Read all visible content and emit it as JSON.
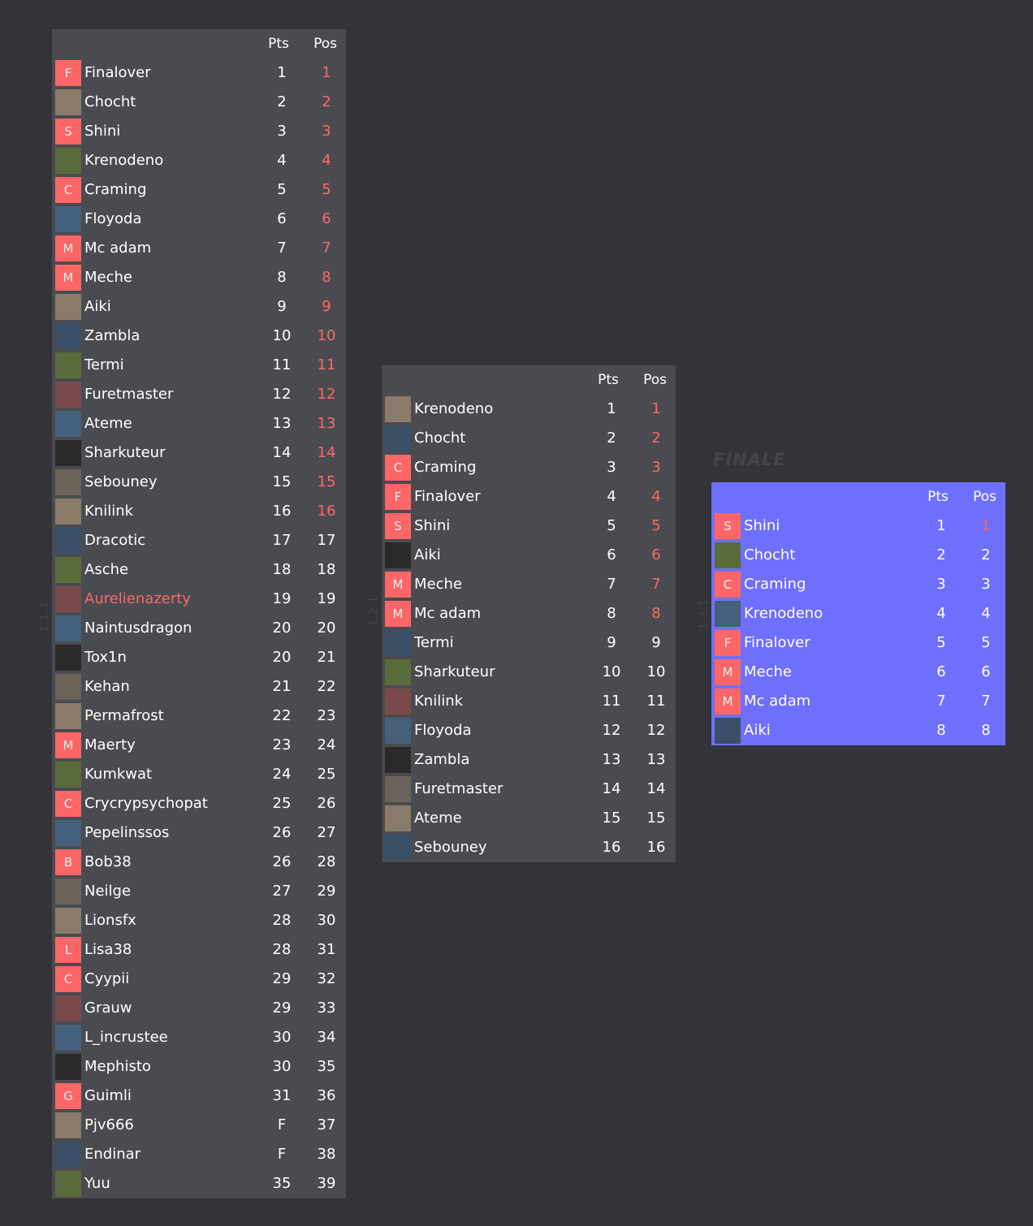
{
  "colors": {
    "page_bg": "#333439",
    "table_bg": "#4a4b50",
    "final_bg": "#6f6ffd",
    "accent_red": "#fd6767"
  },
  "headers": {
    "pts": "Pts",
    "pos": "Pos"
  },
  "groups": [
    {
      "label": "1.1.1",
      "rows": [
        {
          "name": "Finalover",
          "avatar": "F",
          "pts": "1",
          "pos": "1",
          "pos_red": true
        },
        {
          "name": "Chocht",
          "avatar": "img",
          "pts": "2",
          "pos": "2",
          "pos_red": true
        },
        {
          "name": "Shini",
          "avatar": "S",
          "pts": "3",
          "pos": "3",
          "pos_red": true
        },
        {
          "name": "Krenodeno",
          "avatar": "img",
          "pts": "4",
          "pos": "4",
          "pos_red": true
        },
        {
          "name": "Craming",
          "avatar": "C",
          "pts": "5",
          "pos": "5",
          "pos_red": true
        },
        {
          "name": "Floyoda",
          "avatar": "img",
          "pts": "6",
          "pos": "6",
          "pos_red": true
        },
        {
          "name": "Mc adam",
          "avatar": "M",
          "pts": "7",
          "pos": "7",
          "pos_red": true
        },
        {
          "name": "Meche",
          "avatar": "M",
          "pts": "8",
          "pos": "8",
          "pos_red": true
        },
        {
          "name": "Aiki",
          "avatar": "img",
          "pts": "9",
          "pos": "9",
          "pos_red": true
        },
        {
          "name": "Zambla",
          "avatar": "img",
          "pts": "10",
          "pos": "10",
          "pos_red": true
        },
        {
          "name": "Termi",
          "avatar": "img",
          "pts": "11",
          "pos": "11",
          "pos_red": true
        },
        {
          "name": "Furetmaster",
          "avatar": "img",
          "pts": "12",
          "pos": "12",
          "pos_red": true
        },
        {
          "name": "Ateme",
          "avatar": "img",
          "pts": "13",
          "pos": "13",
          "pos_red": true
        },
        {
          "name": "Sharkuteur",
          "avatar": "img",
          "pts": "14",
          "pos": "14",
          "pos_red": true
        },
        {
          "name": "Sebouney",
          "avatar": "img",
          "pts": "15",
          "pos": "15",
          "pos_red": true
        },
        {
          "name": "Knilink",
          "avatar": "img",
          "pts": "16",
          "pos": "16",
          "pos_red": true
        },
        {
          "name": "Dracotic",
          "avatar": "img",
          "pts": "17",
          "pos": "17"
        },
        {
          "name": "Asche",
          "avatar": "img",
          "pts": "18",
          "pos": "18"
        },
        {
          "name": "Aurelienazerty",
          "avatar": "img",
          "pts": "19",
          "pos": "19",
          "highlight": true
        },
        {
          "name": "Naintusdragon",
          "avatar": "img",
          "pts": "20",
          "pos": "20"
        },
        {
          "name": "Tox1n",
          "avatar": "img",
          "pts": "20",
          "pos": "21"
        },
        {
          "name": "Kehan",
          "avatar": "img",
          "pts": "21",
          "pos": "22"
        },
        {
          "name": "Permafrost",
          "avatar": "img",
          "pts": "22",
          "pos": "23"
        },
        {
          "name": "Maerty",
          "avatar": "M",
          "pts": "23",
          "pos": "24"
        },
        {
          "name": "Kumkwat",
          "avatar": "img",
          "pts": "24",
          "pos": "25"
        },
        {
          "name": "Crycrypsychopat",
          "avatar": "C",
          "pts": "25",
          "pos": "26"
        },
        {
          "name": "Pepelinssos",
          "avatar": "img",
          "pts": "26",
          "pos": "27"
        },
        {
          "name": "Bob38",
          "avatar": "B",
          "pts": "26",
          "pos": "28"
        },
        {
          "name": "Neilge",
          "avatar": "img",
          "pts": "27",
          "pos": "29"
        },
        {
          "name": "Lionsfx",
          "avatar": "img",
          "pts": "28",
          "pos": "30"
        },
        {
          "name": "Lisa38",
          "avatar": "L",
          "pts": "28",
          "pos": "31"
        },
        {
          "name": "Cyypii",
          "avatar": "C",
          "pts": "29",
          "pos": "32"
        },
        {
          "name": "Grauw",
          "avatar": "img",
          "pts": "29",
          "pos": "33"
        },
        {
          "name": "L_incrustee",
          "avatar": "img",
          "pts": "30",
          "pos": "34"
        },
        {
          "name": "Mephisto",
          "avatar": "img",
          "pts": "30",
          "pos": "35"
        },
        {
          "name": "Guimli",
          "avatar": "G",
          "pts": "31",
          "pos": "36"
        },
        {
          "name": "Pjv666",
          "avatar": "img",
          "pts": "F",
          "pos": "37"
        },
        {
          "name": "Endinar",
          "avatar": "img",
          "pts": "F",
          "pos": "38"
        },
        {
          "name": "Yuu",
          "avatar": "img",
          "pts": "35",
          "pos": "39"
        }
      ]
    },
    {
      "label": "1.2.1",
      "rows": [
        {
          "name": "Krenodeno",
          "avatar": "img",
          "pts": "1",
          "pos": "1",
          "pos_red": true
        },
        {
          "name": "Chocht",
          "avatar": "img",
          "pts": "2",
          "pos": "2",
          "pos_red": true
        },
        {
          "name": "Craming",
          "avatar": "C",
          "pts": "3",
          "pos": "3",
          "pos_red": true
        },
        {
          "name": "Finalover",
          "avatar": "F",
          "pts": "4",
          "pos": "4",
          "pos_red": true
        },
        {
          "name": "Shini",
          "avatar": "S",
          "pts": "5",
          "pos": "5",
          "pos_red": true
        },
        {
          "name": "Aiki",
          "avatar": "img",
          "pts": "6",
          "pos": "6",
          "pos_red": true
        },
        {
          "name": "Meche",
          "avatar": "M",
          "pts": "7",
          "pos": "7",
          "pos_red": true
        },
        {
          "name": "Mc adam",
          "avatar": "M",
          "pts": "8",
          "pos": "8",
          "pos_red": true
        },
        {
          "name": "Termi",
          "avatar": "img",
          "pts": "9",
          "pos": "9"
        },
        {
          "name": "Sharkuteur",
          "avatar": "img",
          "pts": "10",
          "pos": "10"
        },
        {
          "name": "Knilink",
          "avatar": "img",
          "pts": "11",
          "pos": "11"
        },
        {
          "name": "Floyoda",
          "avatar": "img",
          "pts": "12",
          "pos": "12"
        },
        {
          "name": "Zambla",
          "avatar": "img",
          "pts": "13",
          "pos": "13"
        },
        {
          "name": "Furetmaster",
          "avatar": "img",
          "pts": "14",
          "pos": "14"
        },
        {
          "name": "Ateme",
          "avatar": "img",
          "pts": "15",
          "pos": "15"
        },
        {
          "name": "Sebouney",
          "avatar": "img",
          "pts": "16",
          "pos": "16"
        }
      ]
    },
    {
      "label": "1.3.1",
      "title": "FINALE",
      "rows": [
        {
          "name": "Shini",
          "avatar": "S",
          "pts": "1",
          "pos": "1",
          "pos_red": true
        },
        {
          "name": "Chocht",
          "avatar": "img",
          "pts": "2",
          "pos": "2"
        },
        {
          "name": "Craming",
          "avatar": "C",
          "pts": "3",
          "pos": "3"
        },
        {
          "name": "Krenodeno",
          "avatar": "img",
          "pts": "4",
          "pos": "4"
        },
        {
          "name": "Finalover",
          "avatar": "F",
          "pts": "5",
          "pos": "5"
        },
        {
          "name": "Meche",
          "avatar": "M",
          "pts": "6",
          "pos": "6"
        },
        {
          "name": "Mc adam",
          "avatar": "M",
          "pts": "7",
          "pos": "7"
        },
        {
          "name": "Aiki",
          "avatar": "img",
          "pts": "8",
          "pos": "8"
        }
      ]
    }
  ]
}
